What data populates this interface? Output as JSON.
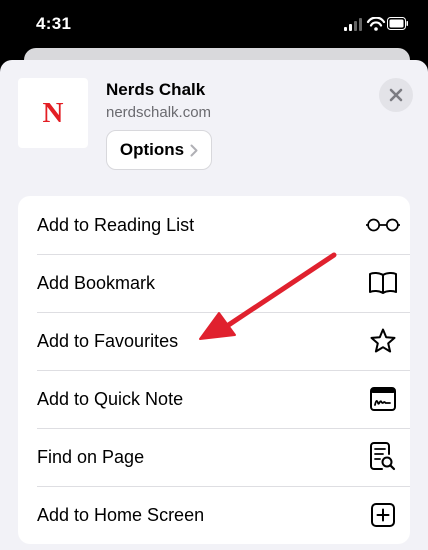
{
  "status_bar": {
    "time": "4:31",
    "icons": [
      "cellular-signal-icon",
      "wifi-icon",
      "battery-icon"
    ]
  },
  "share_sheet": {
    "site": {
      "icon_letter": "N",
      "title": "Nerds Chalk",
      "url": "nerdschalk.com"
    },
    "options_label": "Options",
    "close_icon": "close-icon",
    "actions": [
      {
        "label": "Add to Reading List",
        "icon": "glasses-icon"
      },
      {
        "label": "Add Bookmark",
        "icon": "book-icon"
      },
      {
        "label": "Add to Favourites",
        "icon": "star-icon"
      },
      {
        "label": "Add to Quick Note",
        "icon": "quick-note-icon"
      },
      {
        "label": "Find on Page",
        "icon": "find-on-page-icon"
      },
      {
        "label": "Add to Home Screen",
        "icon": "plus-square-icon"
      }
    ]
  },
  "annotation": {
    "type": "arrow",
    "color": "#e0212e",
    "points_to": "Add to Favourites"
  },
  "colors": {
    "sheet_background": "#f2f2f7",
    "brand_red": "#e31e24"
  }
}
